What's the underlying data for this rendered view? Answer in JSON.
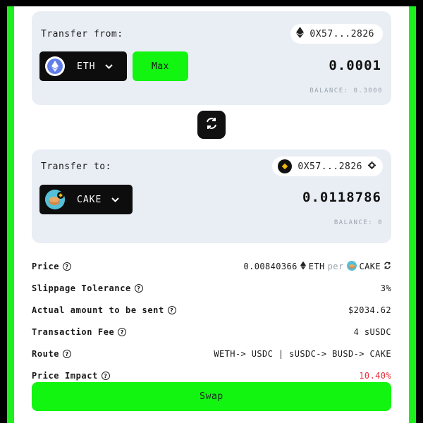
{
  "from": {
    "label": "Transfer from:",
    "address": "0X57...2826",
    "token": "ETH",
    "max_label": "Max",
    "amount": "0.0001",
    "balance": "BALANCE: 0.3000"
  },
  "to": {
    "label": "Transfer to:",
    "address": "0X57...2826",
    "token": "CAKE",
    "amount": "0.0118786",
    "balance": "BALANCE: 0"
  },
  "info": {
    "price_label": "Price",
    "price_value": "0.00840366",
    "price_from_token": "ETH",
    "price_per": "per",
    "price_to_token": "CAKE",
    "slippage_label": "Slippage Tolerance",
    "slippage_value": "3%",
    "actual_label": "Actual amount to be sent",
    "actual_value": "$2034.62",
    "fee_label": "Transaction Fee",
    "fee_value": "4 sUSDC",
    "route_label": "Route",
    "route_value": "WETH-> USDC | sUSDC-> BUSD-> CAKE",
    "impact_label": "Price Impact",
    "impact_value": "10.40%"
  },
  "swap_label": "Swap",
  "colors": {
    "accent_green": "#11f511",
    "frame_green": "#1ef01e",
    "card_bg": "#e9eef5",
    "impact_red": "#e5313b",
    "bnb_yellow": "#f0b90b"
  },
  "icons": {
    "eth": "ethereum-icon",
    "bnb": "bnb-chain-icon",
    "cake": "pancakeswap-cake-icon",
    "swap_direction": "swap-arrows-icon",
    "settings": "gear-icon",
    "help": "question-circle-icon",
    "refresh": "refresh-icon"
  }
}
